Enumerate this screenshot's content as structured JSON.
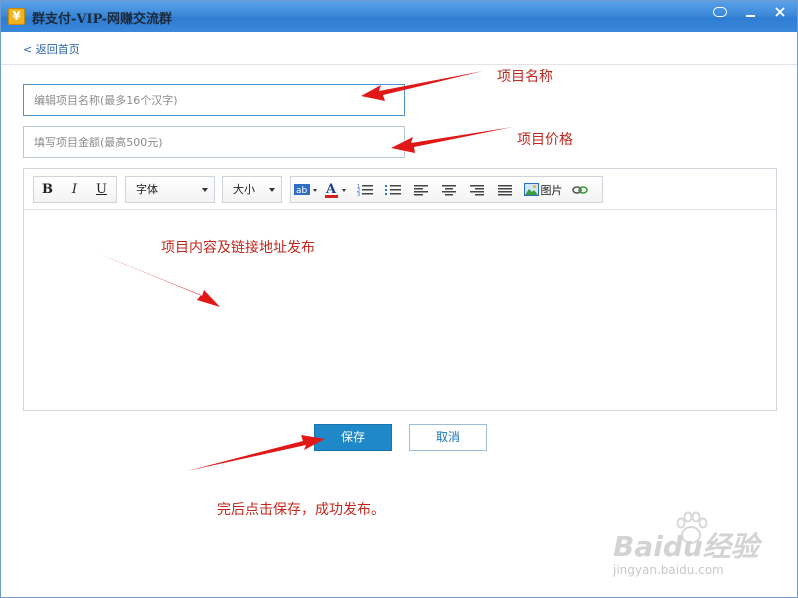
{
  "window": {
    "title": "群支付-VIP-网赚交流群",
    "app_icon_glyph": "¥"
  },
  "nav": {
    "back_link": "< 返回首页"
  },
  "form": {
    "name_placeholder": "编辑项目名称(最多16个汉字)",
    "price_placeholder": "填写项目金额(最高500元)"
  },
  "toolbar": {
    "bold": "B",
    "italic": "I",
    "underline": "U",
    "font_select": "字体",
    "size_select": "大小",
    "image_label": "图片"
  },
  "buttons": {
    "save": "保存",
    "cancel": "取消"
  },
  "annotations": {
    "name": "项目名称",
    "price": "项目价格",
    "content": "项目内容及链接地址发布",
    "finish": "完后点击保存，成功发布。"
  },
  "watermark": {
    "main": "Baidu经验",
    "sub": "jingyan.baidu.com"
  },
  "colors": {
    "accent": "#1e88c8",
    "annotation": "#c0281f",
    "titlebar": "#3d8ad9"
  }
}
